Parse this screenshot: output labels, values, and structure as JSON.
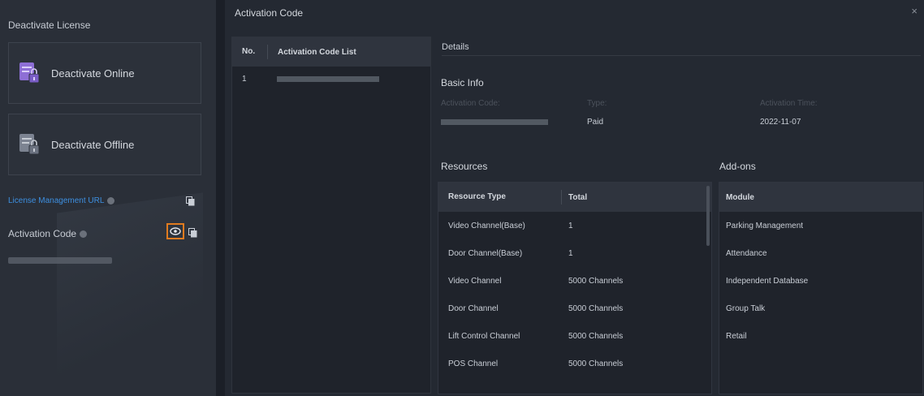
{
  "left_panel": {
    "title": "Deactivate License",
    "deactivate_online": "Deactivate Online",
    "deactivate_offline": "Deactivate Offline",
    "license_url_label": "License Management URL",
    "activation_code_label": "Activation Code"
  },
  "dialog": {
    "title": "Activation Code",
    "close": "×",
    "code_list": {
      "col_no": "No.",
      "col_list": "Activation Code List",
      "rows": [
        {
          "no": "1"
        }
      ]
    },
    "details": {
      "header": "Details",
      "basic_info": "Basic Info",
      "activation_code_label": "Activation Code:",
      "type_label": "Type:",
      "type_value": "Paid",
      "activation_time_label": "Activation Time:",
      "activation_time_value": "2022-11-07"
    },
    "resources": {
      "title": "Resources",
      "col_type": "Resource Type",
      "col_total": "Total",
      "rows": [
        {
          "type": "Video Channel(Base)",
          "total": "1"
        },
        {
          "type": "Door Channel(Base)",
          "total": "1"
        },
        {
          "type": "Video Channel",
          "total": "5000 Channels"
        },
        {
          "type": "Door Channel",
          "total": "5000 Channels"
        },
        {
          "type": "Lift Control Channel",
          "total": "5000 Channels"
        },
        {
          "type": "POS Channel",
          "total": "5000 Channels"
        }
      ]
    },
    "addons": {
      "title": "Add-ons",
      "col_module": "Module",
      "rows": [
        "Parking Management",
        "Attendance",
        "Independent Database",
        "Group Talk",
        "Retail"
      ]
    }
  },
  "colors": {
    "accent_link": "#3d8fe0",
    "highlight_border": "#e07b1f",
    "license_icon": "#8e6fd6"
  },
  "icons": [
    "license-online-icon",
    "license-offline-icon",
    "help-icon",
    "copy-icon",
    "eye-icon",
    "close-icon"
  ]
}
